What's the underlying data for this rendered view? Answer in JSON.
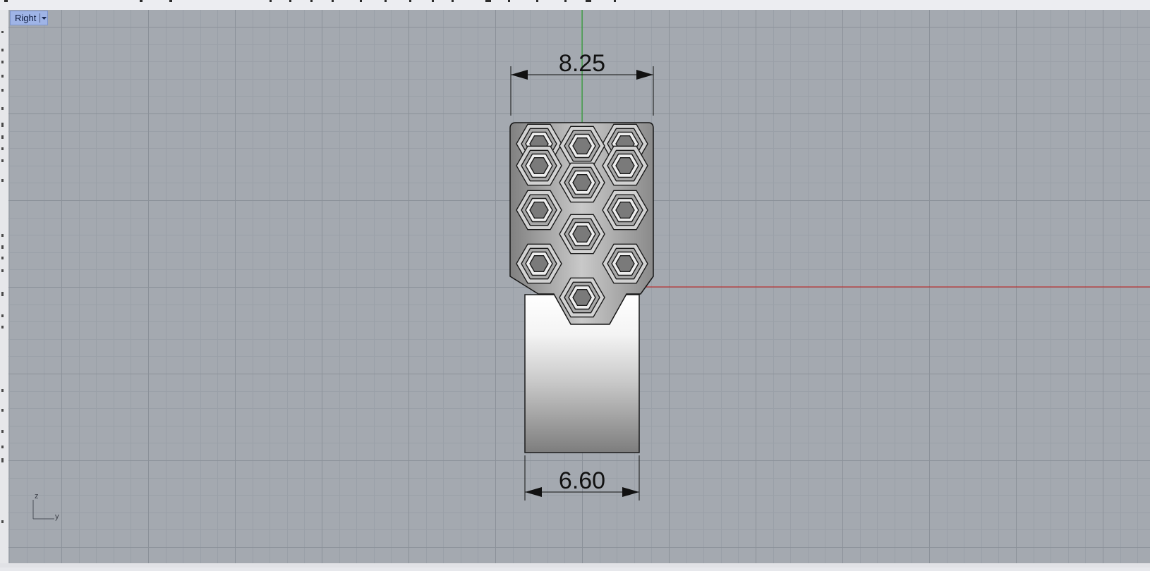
{
  "viewport": {
    "name": "Right",
    "menu_icon": "chevron-down-icon",
    "dimensions": {
      "top": "8.25",
      "bottom": "6.60"
    },
    "axis_labels": {
      "vertical": "z",
      "horizontal": "y"
    },
    "colors": {
      "background": "#a4a9b0",
      "grid_minor": "#9aa0a8",
      "grid_major": "#8b9199",
      "axis_x": "#c21a1a",
      "axis_y": "#1aa31a",
      "tab": "#9fb4e6"
    }
  }
}
